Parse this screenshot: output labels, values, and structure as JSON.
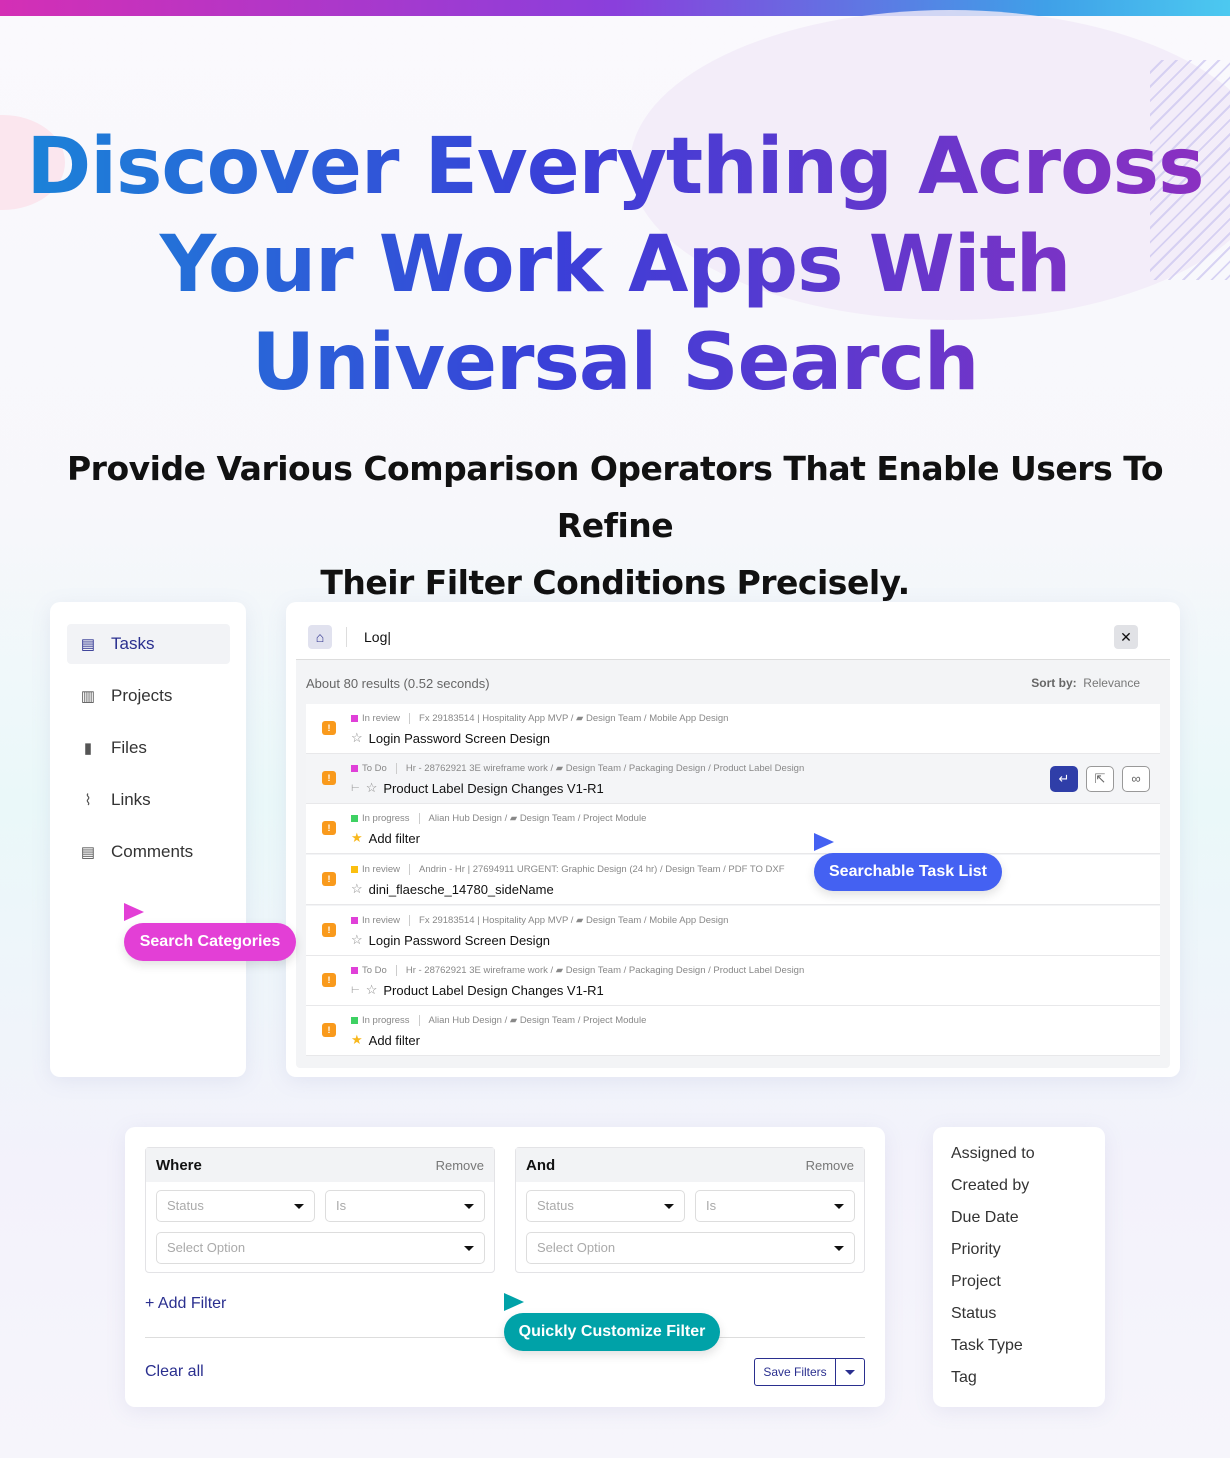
{
  "headline": [
    "Discover Everything Across",
    "Your Work Apps With",
    "Universal Search"
  ],
  "subheadline": [
    "Provide Various Comparison Operators That Enable Users To Refine",
    "Their Filter Conditions Precisely."
  ],
  "sidebar": {
    "items": [
      {
        "label": "Tasks",
        "icon": "tasks-icon",
        "active": true
      },
      {
        "label": "Projects",
        "icon": "projects-icon"
      },
      {
        "label": "Files",
        "icon": "file-icon"
      },
      {
        "label": "Links",
        "icon": "paperclip-icon"
      },
      {
        "label": "Comments",
        "icon": "comment-icon"
      }
    ]
  },
  "search": {
    "query": "Log|",
    "result_count": "About 80 results (0.52 seconds)",
    "sort_label": "Sort by:",
    "sort_value": "Relevance",
    "results": [
      {
        "status": "In review",
        "status_color": "#e040d8",
        "path": "Fx 29183514 | Hospitality App MVP / ",
        "folder": "Design Team / Mobile App Design",
        "title": "Login Password Screen Design",
        "starred": false,
        "subtask": false
      },
      {
        "status": "To Do",
        "status_color": "#e040d8",
        "path": "Hr - 28762921 3E wireframe work / ",
        "folder": "Design Team / Packaging Design / Product Label Design",
        "title": "Product Label Design Changes V1-R1",
        "starred": false,
        "subtask": true,
        "highlighted": true
      },
      {
        "status": "In progress",
        "status_color": "#3ed163",
        "path": "Alian Hub Design / ",
        "folder": "Design Team / Project Module",
        "title": "Add filter",
        "starred": true,
        "subtask": false
      },
      {
        "status": "In review",
        "status_color": "#fbbf10",
        "path": "Andrin - Hr | 27694911 URGENT: Graphic Design (24 hr) / Design Team / PDF TO DXF",
        "folder": "",
        "title": "dini_flaesche_14780_sideName",
        "starred": false,
        "subtask": false
      },
      {
        "status": "In review",
        "status_color": "#e040d8",
        "path": "Fx 29183514 | Hospitality App MVP / ",
        "folder": "Design Team / Mobile App Design",
        "title": "Login Password Screen Design",
        "starred": false,
        "subtask": false
      },
      {
        "status": "To Do",
        "status_color": "#e040d8",
        "path": "Hr - 28762921 3E wireframe work / ",
        "folder": "Design Team / Packaging Design / Product Label Design",
        "title": "Product Label Design Changes V1-R1",
        "starred": false,
        "subtask": true
      },
      {
        "status": "In progress",
        "status_color": "#3ed163",
        "path": "Alian Hub Design / ",
        "folder": "Design Team / Project Module",
        "title": "Add filter",
        "starred": true,
        "subtask": false
      }
    ]
  },
  "callouts": {
    "categories": "Search Categories",
    "task_list": "Searchable Task List",
    "filter": "Quickly Customize Filter"
  },
  "filter": {
    "groups": [
      {
        "label": "Where",
        "remove": "Remove",
        "field": "Status",
        "operator": "Is",
        "value": "Select Option"
      },
      {
        "label": "And",
        "remove": "Remove",
        "field": "Status",
        "operator": "Is",
        "value": "Select Option"
      }
    ],
    "add_filter": "+ Add Filter",
    "clear_all": "Clear all",
    "save": "Save Filters"
  },
  "fields": [
    "Assigned to",
    "Created by",
    "Due Date",
    "Priority",
    "Project",
    "Status",
    "Task Type",
    "Tag"
  ],
  "colors": {
    "primary": "#2a2f8f",
    "magenta": "#e33fd6",
    "blue": "#4461f2",
    "teal": "#00a2a8"
  }
}
